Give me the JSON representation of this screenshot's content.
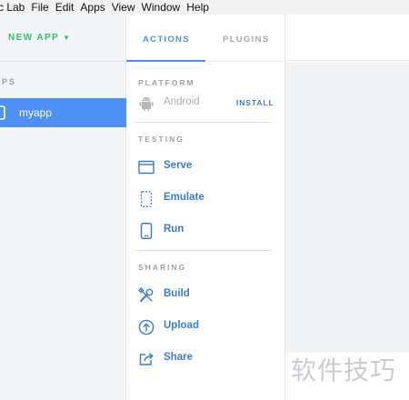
{
  "menubar": {
    "items": [
      "c Lab",
      "File",
      "Edit",
      "Apps",
      "View",
      "Window",
      "Help"
    ]
  },
  "sidebar": {
    "new_app": "NEW APP",
    "apps_heading": "PPS",
    "apps": [
      {
        "label": "myapp",
        "selected": true
      }
    ]
  },
  "tabs": {
    "actions": "ACTIONS",
    "plugins": "PLUGINS",
    "active": "ACTIONS"
  },
  "platform": {
    "heading": "PLATFORM",
    "item": "Android",
    "install": "INSTALL"
  },
  "testing": {
    "heading": "TESTING",
    "items": [
      {
        "label": "Serve",
        "icon": "browser-window-icon"
      },
      {
        "label": "Emulate",
        "icon": "emulate-device-icon"
      },
      {
        "label": "Run",
        "icon": "phone-icon"
      }
    ]
  },
  "sharing": {
    "heading": "SHARING",
    "items": [
      {
        "label": "Build",
        "icon": "build-tools-icon"
      },
      {
        "label": "Upload",
        "icon": "upload-icon"
      },
      {
        "label": "Share",
        "icon": "share-icon"
      }
    ]
  },
  "watermark": "软件技巧",
  "colors": {
    "accent": "#4d8ff5",
    "link": "#3a7be0",
    "new_app_green": "#2ec26b",
    "heading_gray": "#9aa1aa"
  }
}
